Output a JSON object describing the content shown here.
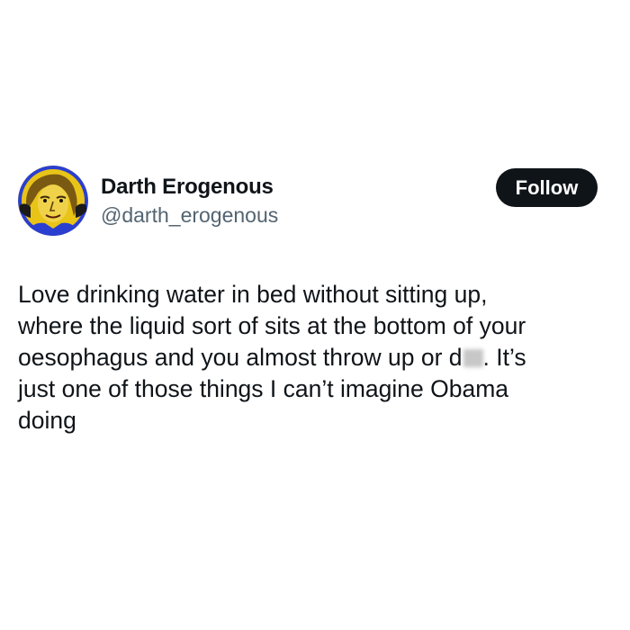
{
  "user": {
    "display_name": "Darth Erogenous",
    "handle": "@darth_erogenous"
  },
  "actions": {
    "follow_label": "Follow"
  },
  "tweet": {
    "lines": [
      "Love drinking water in bed without sitting up,",
      "where the liquid sort of sits at the bottom of your",
      "oesophagus and you almost throw up or d",
      ". It’s",
      "just one of those things  I can’t imagine Obama",
      "doing"
    ]
  },
  "colors": {
    "text": "#0f1419",
    "secondary_text": "#536471",
    "button_bg": "#0f1419",
    "avatar_bg": "#f2d31c",
    "avatar_border": "#2a3fd0"
  },
  "icons": {
    "avatar": "profile-portrait-icon",
    "redaction": "blurred-word"
  }
}
